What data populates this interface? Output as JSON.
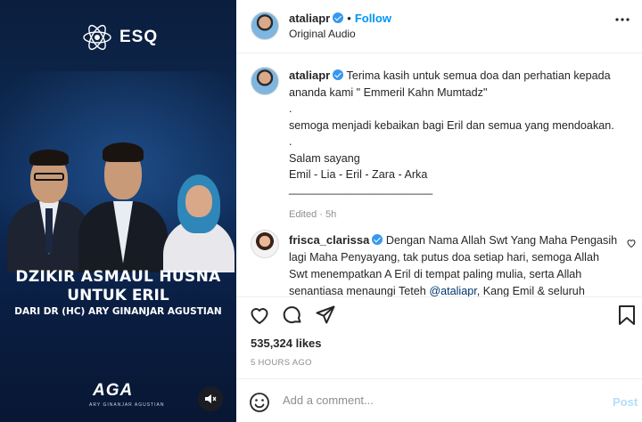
{
  "media": {
    "logo_text": "ESQ",
    "title_line1": "DZIKIR ASMAUL HUSNA",
    "title_line2": "UNTUK ERIL",
    "title_line3": "DARI DR (HC) ARY GINANJAR AGUSTIAN",
    "brand_text": "AGA",
    "brand_subtext": "ARY GINANJAR AGUSTIAN"
  },
  "header": {
    "username": "ataliapr",
    "follow_label": "Follow",
    "dot": "•",
    "audio": "Original Audio"
  },
  "caption": {
    "username": "ataliapr",
    "line1": "Terima kasih untuk semua doa dan perhatian kepada ananda kami \" Emmeril Kahn Mumtadz\"",
    "line2": ".",
    "line3": "semoga menjadi kebaikan bagi Eril dan semua yang mendoakan.",
    "line4": ".",
    "line5": "Salam sayang",
    "line6": "Emil - Lia - Eril - Zara - Arka",
    "line7": "_______________________",
    "meta": "Edited · 5h"
  },
  "comment": {
    "username": "frisca_clarissa",
    "text": "Dengan Nama Allah Swt Yang Maha Pengasih lagi Maha Penyayang, tak putus doa setiap hari, semoga Allah Swt menempatkan A Eril di tempat paling mulia, serta Allah senantiasa menaungi Teteh",
    "mention": "@ataliapr",
    "text_end": ", Kang Emil & seluruh"
  },
  "actions": {
    "likes": "535,324 likes",
    "time": "5 HOURS AGO"
  },
  "comment_box": {
    "placeholder": "Add a comment...",
    "post_label": "Post"
  },
  "colors": {
    "accent": "#0095f6",
    "verified": "#3897f0",
    "muted": "#8e8e8e"
  }
}
